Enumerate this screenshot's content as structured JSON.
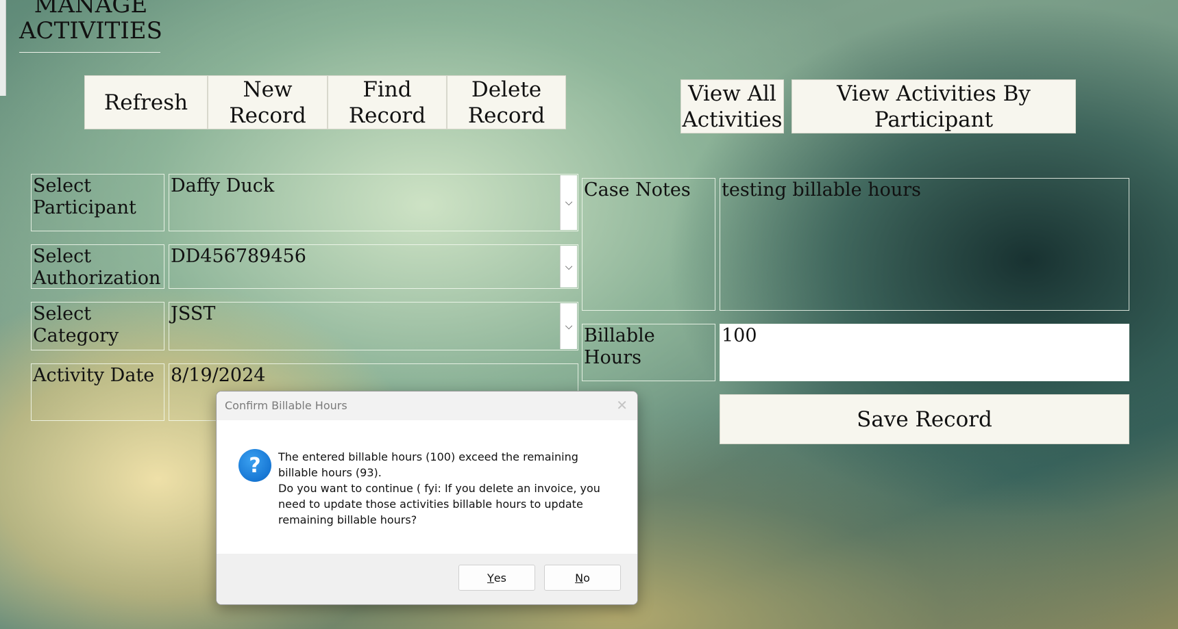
{
  "page": {
    "title_line1": "MANAGE",
    "title_line2": "ACTIVITIES"
  },
  "toolbar": {
    "refresh": "Refresh",
    "new_record_l1": "New",
    "new_record_l2": "Record",
    "find_record_l1": "Find",
    "find_record_l2": "Record",
    "delete_record_l1": "Delete",
    "delete_record_l2": "Record",
    "view_all_l1": "View All",
    "view_all_l2": "Activities",
    "view_by_participant_l1": "View Activities By",
    "view_by_participant_l2": "Participant"
  },
  "form": {
    "participant": {
      "label_l1": "Select",
      "label_l2": "Participant",
      "value": "Daffy Duck"
    },
    "authorization": {
      "label_l1": "Select",
      "label_l2": "Authorization",
      "value": "DD456789456"
    },
    "category": {
      "label_l1": "Select",
      "label_l2": "Category",
      "value": "JSST"
    },
    "activity_date": {
      "label": "Activity Date",
      "value": "8/19/2024"
    },
    "case_notes": {
      "label": "Case Notes",
      "value": "testing billable hours"
    },
    "billable_hours": {
      "label": "Billable Hours",
      "value": "100"
    },
    "save": "Save Record",
    "dropdown_glyph": "⌵"
  },
  "dialog": {
    "title": "Confirm Billable Hours",
    "close_glyph": "✕",
    "icon_glyph": "?",
    "message_l1": "The entered billable hours (100) exceed the remaining billable hours (93).",
    "message_l2": "Do you want to continue ( fyi: If you delete an invoice, you need to update those activities billable hours to update remaining billable hours?",
    "yes_underline": "Y",
    "yes_rest": "es",
    "no_underline": "N",
    "no_rest": "o"
  }
}
